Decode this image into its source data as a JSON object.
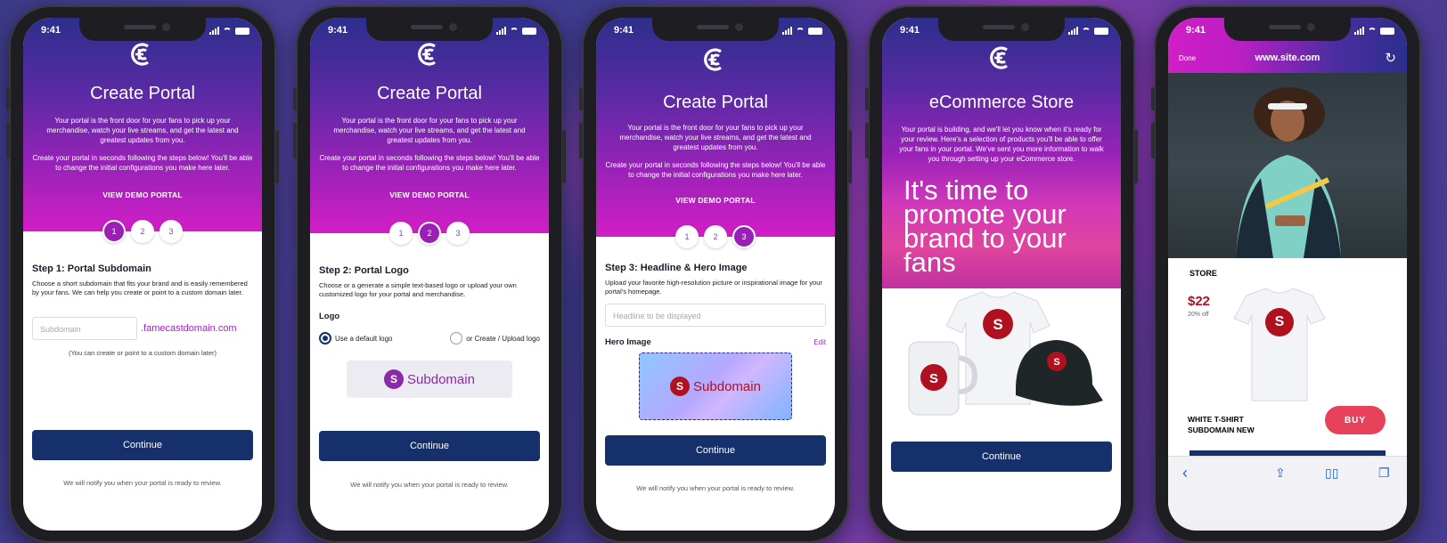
{
  "status": {
    "time": "9:41"
  },
  "common": {
    "title": "Create Portal",
    "intro": "Your portal is the front door for your fans to pick up your merchandise, watch your live streams, and get the latest and greatest updates from you.",
    "intro2": "Create your portal in seconds following the steps below! You'll be able to change the initial configurations you make here later.",
    "demo_link": "VIEW DEMO PORTAL",
    "steps": [
      "1",
      "2",
      "3"
    ],
    "continue_label": "Continue",
    "notify": "We will notify you when your portal is ready to review."
  },
  "screen1": {
    "heading": "Step 1: Portal Subdomain",
    "desc": "Choose a short subdomain that fits your brand and is easily remembered by your fans. We can help you create or point to a custom domain later.",
    "subdomain_placeholder": "Subdomain",
    "domain_suffix": ".famecastdomain.com",
    "hint": "(You can create or point to a custom domain later)"
  },
  "screen2": {
    "heading": "Step 2: Portal Logo",
    "desc": "Choose or a generate a simple text-based logo or upload your own customized logo for your portal and merchandise.",
    "logo_label": "Logo",
    "option_default": "Use a default logo",
    "option_upload": "or Create / Upload logo",
    "preview_letter": "S",
    "preview_text": "Subdomain"
  },
  "screen3": {
    "heading": "Step 3: Headline & Hero Image",
    "desc": "Upload your favorite high-resolution picture or inspirational image for your portal's homepage.",
    "headline_placeholder": "Headline to be displayed",
    "hero_label": "Hero Image",
    "edit_label": "Edit",
    "preview_letter": "S",
    "preview_text": "Subdomain"
  },
  "screen4": {
    "title": "eCommerce Store",
    "desc": "Your portal is building, and we'll let you know when it's ready for your review. Here's a selection of products you'll be able to offer your fans in your portal. We've sent you more information to walk you through setting up your eCommerce store.",
    "promo": "It's time to promote your brand to your fans",
    "product_letter": "S"
  },
  "screen5": {
    "done_label": "Done",
    "url": "www.site.com",
    "store_label": "STORE",
    "price": "$22",
    "discount": "20% off",
    "product_letter": "S",
    "product_name_line1": "WHITE T-SHIRT",
    "product_name_line2": "SUBDOMAIN NEW",
    "buy_label": "BUY"
  },
  "colors": {
    "primary_navy": "#15306b",
    "accent_purple": "#a323c8",
    "buy_red": "#e8425a",
    "brand_red": "#b0111f"
  }
}
